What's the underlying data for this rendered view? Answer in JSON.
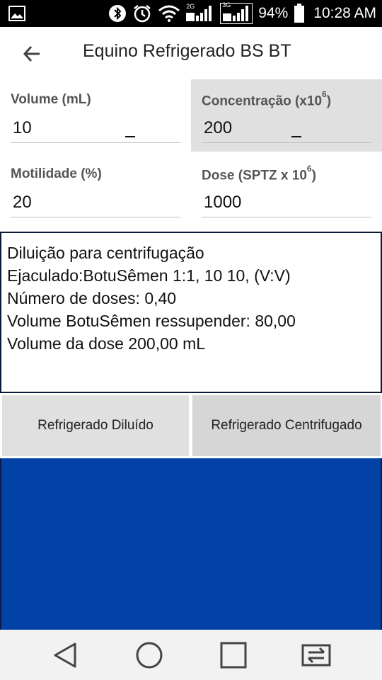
{
  "status_bar": {
    "net_2g": "2G",
    "net_3g": "3G",
    "battery": "94%",
    "time": "10:28 AM"
  },
  "app_bar": {
    "title": "Equino Refrigerado BS BT"
  },
  "fields": {
    "volume": {
      "label": "Volume (mL)",
      "value": "10"
    },
    "concentracao": {
      "label": "Concentração (x10",
      "sup": "6",
      "label_end": ")",
      "value": "200"
    },
    "motilidade": {
      "label": "Motilidade (%)",
      "value": "20"
    },
    "dose": {
      "label": "Dose (SPTZ x 10",
      "sup": "6",
      "label_end": ")",
      "value": "1000"
    }
  },
  "result": {
    "lines": [
      "Diluição para centrifugação",
      "Ejaculado:BotuSêmen 1:1, 10 10, (V:V)",
      "Número de doses: 0,40",
      "Volume BotuSêmen ressupender: 80,00",
      "Volume da dose 200,00 mL"
    ]
  },
  "buttons": {
    "diluido": "Refrigerado Diluído",
    "centrifugado": "Refrigerado Centrifugado"
  },
  "colors": {
    "panel_blue": "#0242a6",
    "grey_cell": "#e0e0e0"
  }
}
